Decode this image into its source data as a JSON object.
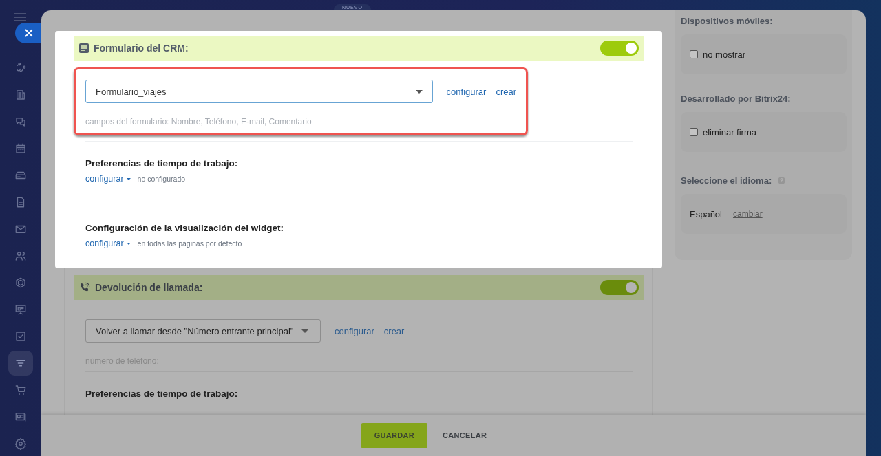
{
  "badge": "NUEVO",
  "sidebar": {
    "items": [
      {
        "selected": false
      },
      {
        "selected": false
      },
      {
        "selected": false
      },
      {
        "selected": false
      },
      {
        "selected": false
      },
      {
        "selected": false
      },
      {
        "selected": false
      },
      {
        "selected": false
      },
      {
        "selected": false
      },
      {
        "selected": false
      },
      {
        "selected": false
      },
      {
        "selected": true
      },
      {
        "selected": false
      },
      {
        "selected": false
      },
      {
        "selected": false
      }
    ]
  },
  "crm_form": {
    "title": "Formulario del CRM:",
    "enabled": true,
    "highlighted": true,
    "select": "Formulario_viajes",
    "links": [
      "configurar",
      "crear"
    ],
    "hint": "campos del formulario: Nombre, Teléfono, E-mail, Comentario"
  },
  "settings": [
    {
      "title": "Preferencias de tiempo de trabajo:",
      "link": "configurar",
      "note": "no configurado"
    },
    {
      "title": "Configuración de la visualización del widget:",
      "link": "configurar",
      "note": "en todas las páginas por defecto"
    }
  ],
  "callback": {
    "title": "Devolución de llamada:",
    "enabled": true,
    "select": "Volver a llamar desde \"Número entrante principal\"",
    "links": [
      "configurar",
      "crear"
    ],
    "hint": "número de teléfono:",
    "next_title": "Preferencias de tiempo de trabajo:"
  },
  "right": {
    "mobile": {
      "title": "Dispositivos móviles:",
      "option": "no mostrar",
      "checked": false
    },
    "branding": {
      "title": "Desarrollado por Bitrix24:",
      "option": "eliminar firma",
      "checked": false
    },
    "language": {
      "title": "Seleccione el idioma:",
      "value": "Español",
      "link": "cambiar"
    }
  },
  "footer": {
    "buttons": [
      "GUARDAR",
      "CANCELAR"
    ]
  }
}
